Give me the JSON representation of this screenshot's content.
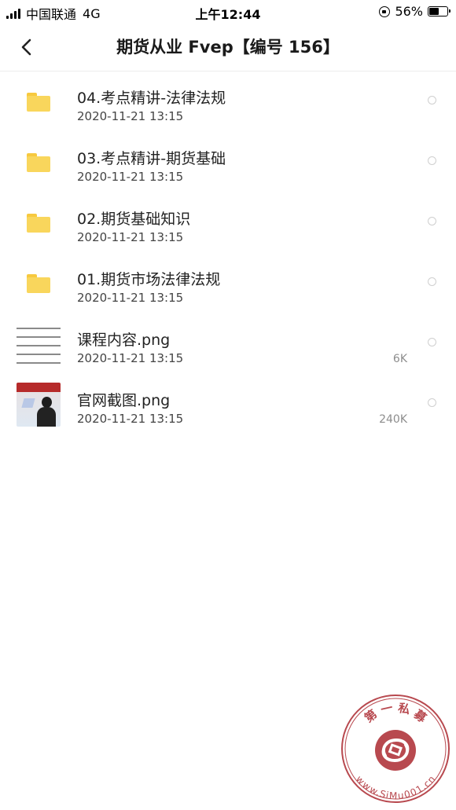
{
  "status_bar": {
    "carrier": "中国联通",
    "network": "4G",
    "time": "上午12:44",
    "battery_percent": "56%",
    "battery_level": 0.56
  },
  "nav": {
    "back_icon": "chevron-left-icon",
    "title": "期货从业 Fvep【编号 156】"
  },
  "files": [
    {
      "type": "folder",
      "icon": "folder-icon",
      "name": "04.考点精讲-法律法规",
      "date": "2020-11-21 13:15",
      "size": ""
    },
    {
      "type": "folder",
      "icon": "folder-icon",
      "name": "03.考点精讲-期货基础",
      "date": "2020-11-21 13:15",
      "size": ""
    },
    {
      "type": "folder",
      "icon": "folder-icon",
      "name": "02.期货基础知识",
      "date": "2020-11-21 13:15",
      "size": ""
    },
    {
      "type": "folder",
      "icon": "folder-icon",
      "name": "01.期货市场法律法规",
      "date": "2020-11-21 13:15",
      "size": ""
    },
    {
      "type": "image",
      "icon": "image-thumbnail-text",
      "name": "课程内容.png",
      "date": "2020-11-21 13:15",
      "size": "6K"
    },
    {
      "type": "image",
      "icon": "image-thumbnail-photo",
      "name": "官网截图.png",
      "date": "2020-11-21 13:15",
      "size": "240K"
    }
  ],
  "watermark": {
    "top_text": "第 一 私 募",
    "bottom_text": "www.SiMu001.cn",
    "color": "#b8494f"
  }
}
